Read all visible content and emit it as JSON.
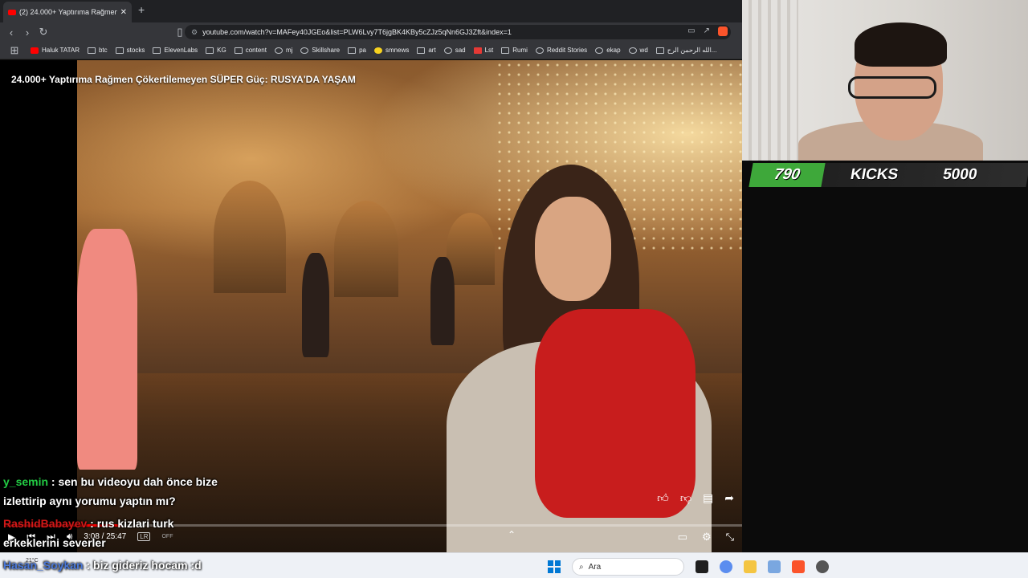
{
  "browser": {
    "tab_title": "(2) 24.000+ Yaptırıma Rağmen...",
    "tab_close": "✕",
    "new_tab": "+",
    "url": "youtube.com/watch?v=MAFey40JGEo&list=PLW6Lvy7T6jgBK4KBy5cZJz5qNn6GJ3Zft&index=1",
    "bookmarks": [
      "Haluk TATAR",
      "btc",
      "stocks",
      "ElevenLabs",
      "KG",
      "content",
      "mj",
      "Skillshare",
      "pa",
      "smnews",
      "art",
      "sad",
      "Lst",
      "Rumi",
      "Reddit Stories",
      "ekap",
      "wd",
      "الله الرحمن الرح..."
    ]
  },
  "video": {
    "title": "24.000+ Yaptırıma Rağmen Çökertilemeyen SÜPER Güç: RUSYA'DA YAŞAM",
    "time": "3:08 / 25:47",
    "cc_label": "LR",
    "cc_state": "OFF",
    "progress": 0.12
  },
  "kicks_bar": {
    "count": "790",
    "label": "KICKS",
    "goal": "5000"
  },
  "chat": [
    {
      "user": "y_semin",
      "color": "green",
      "text": " : sen bu videoyu dah önce bize"
    },
    {
      "user": "",
      "color": "",
      "text": "izlettirip aynı yorumu yaptın mı?"
    },
    {
      "user": "RashidBabayev",
      "color": "red",
      "text": " : rus kizlari turk"
    },
    {
      "user": "",
      "color": "",
      "text": "erkeklerini severler"
    },
    {
      "user": "Hasan_Soykan",
      "color": "blue",
      "text": " : biz gideriz hocam :d"
    }
  ],
  "taskbar": {
    "weather": "21°C",
    "search_placeholder": "Ara"
  },
  "colors": {
    "kicks_green": "#3ea83a",
    "progress_red": "#ff0000",
    "chat_green": "#22cc44",
    "chat_red": "#d01818",
    "chat_blue": "#4a78d8"
  }
}
